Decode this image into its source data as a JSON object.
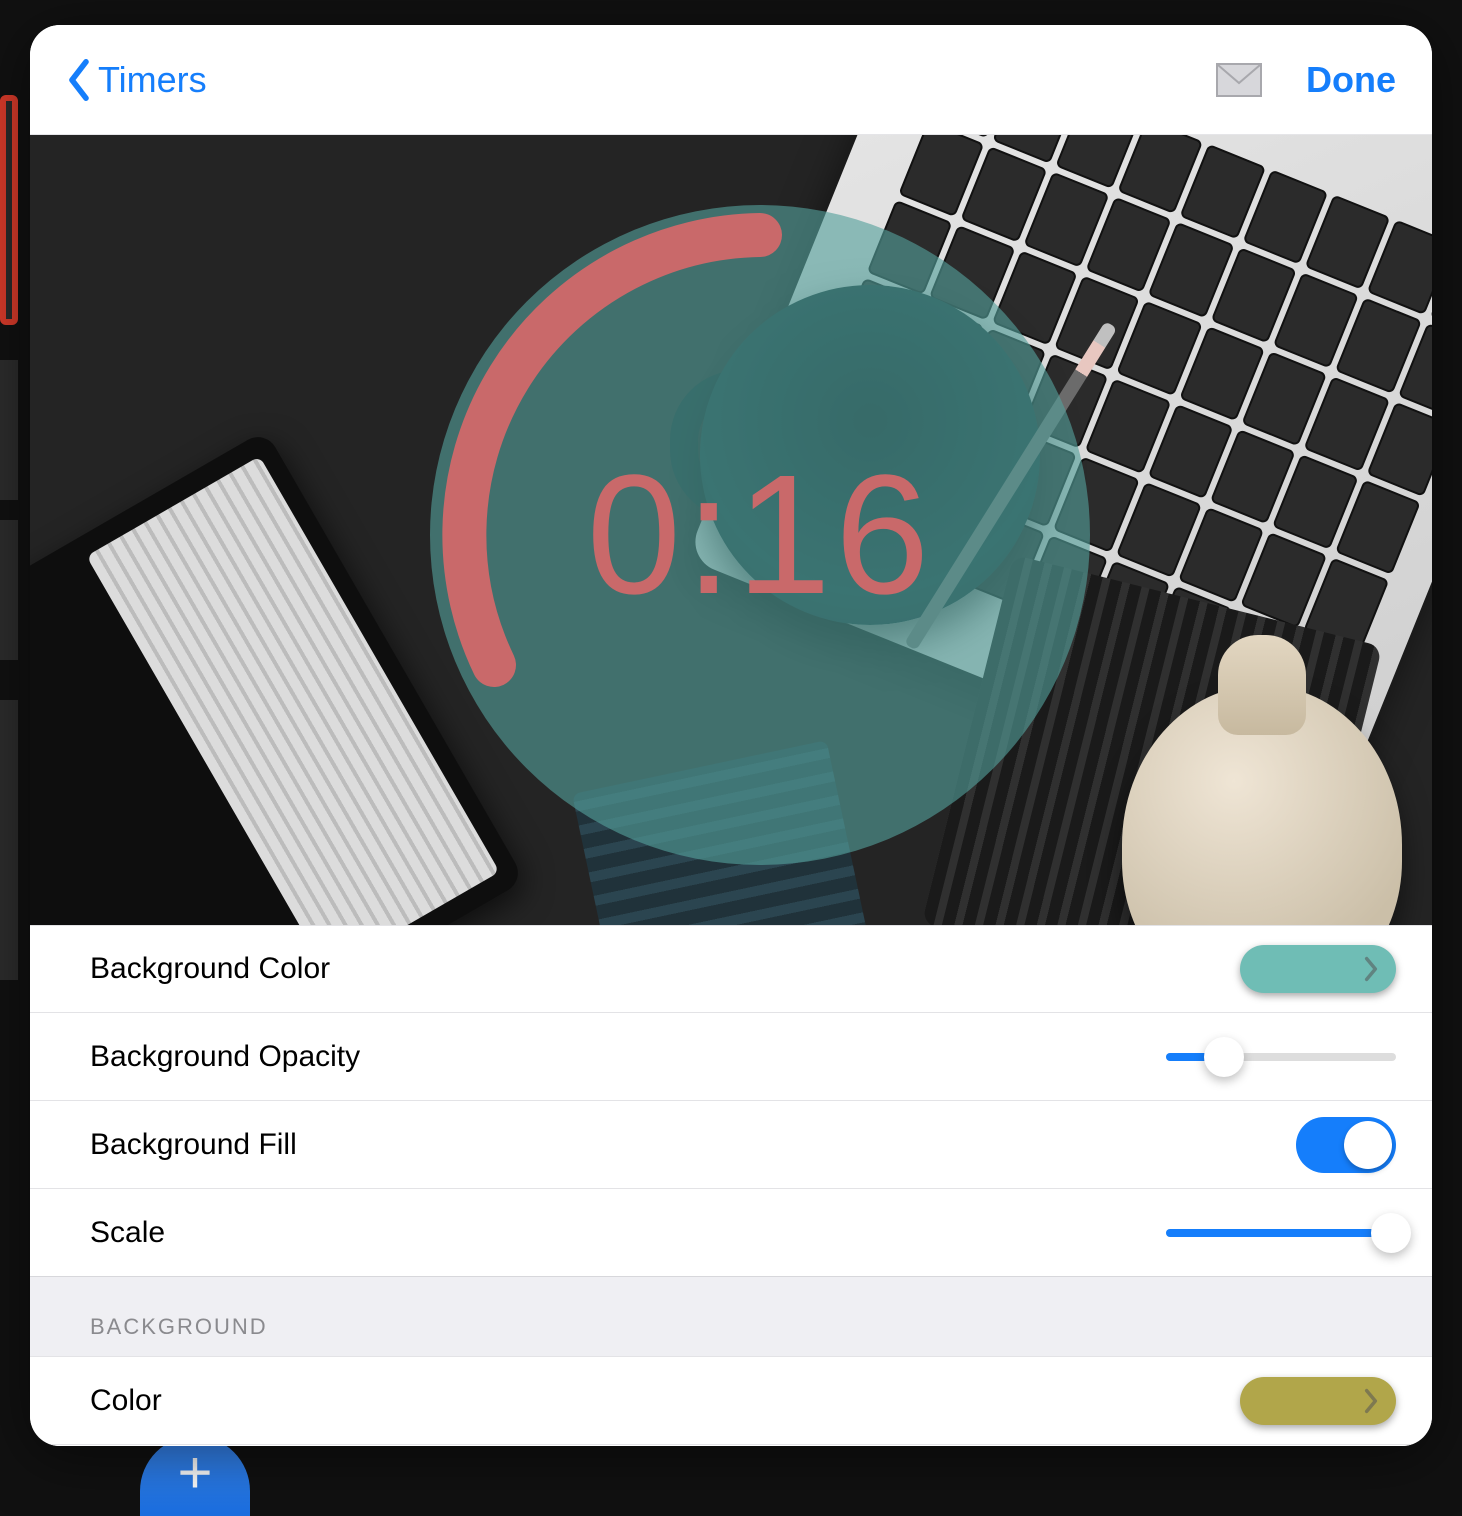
{
  "nav": {
    "back_label": "Timers",
    "done_label": "Done"
  },
  "preview": {
    "timer_text": "0:16",
    "arc_color": "#c9696a",
    "circle_color": "rgba(84,160,155,0.62)"
  },
  "settings": {
    "bg_color": {
      "label": "Background Color",
      "swatch": "#6fbdb5"
    },
    "bg_opacity": {
      "label": "Background Opacity",
      "value": 0.25
    },
    "bg_fill": {
      "label": "Background Fill",
      "on": true
    },
    "scale": {
      "label": "Scale",
      "value": 0.98
    }
  },
  "sections": {
    "background_header": "BACKGROUND"
  },
  "section_rows": {
    "color": {
      "label": "Color",
      "swatch": "#b1a64a"
    }
  },
  "colors": {
    "accent": "#157efb"
  }
}
